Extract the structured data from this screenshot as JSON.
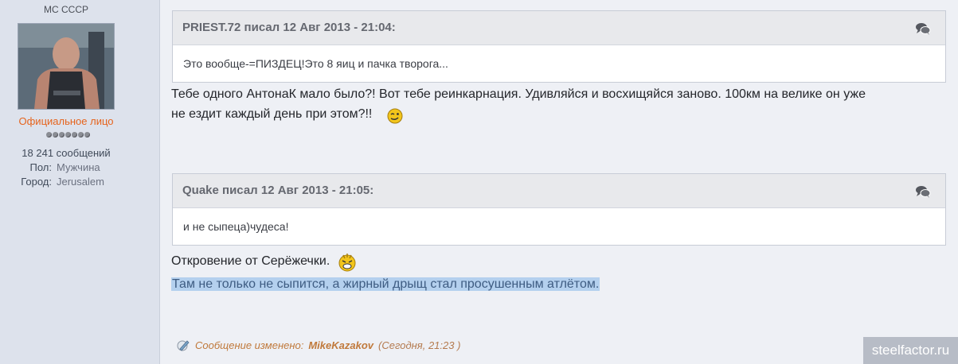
{
  "author": {
    "rank": "МС СССР",
    "role": "Официальное лицо",
    "posts": "18 241 сообщений",
    "gender_label": "Пол:",
    "gender": "Мужчина",
    "city_label": "Город:",
    "city": "Jerusalem",
    "pips_count": 7
  },
  "quote1": {
    "header": "PRIEST.72 писал 12 Авг 2013 - 21:04:",
    "body": "Это вообще-=ПИЗДЕЦ!Это 8 яиц и пачка творога...",
    "icon": "speech-bubbles-icon"
  },
  "reply1": {
    "line1": "Тебе одного АнтонаК мало было?! Вот тебе реинкарнация. Удивляйся и восхищяйся заново. 100км на велике он уже",
    "line2": "не ездит каждый день при этом?!!"
  },
  "quote2": {
    "header": "Quake писал 12 Авг 2013 - 21:05:",
    "body": "и не сыпеца)чудеса!",
    "icon": "speech-bubbles-icon"
  },
  "reply2": {
    "line1": "Откровение от Серёжечки.",
    "line2": "Там не только не сыпится, а жирный дрыщ стал просушенным атлётом."
  },
  "edited": {
    "label": "Сообщение изменено:",
    "user": "MikeKazakov",
    "time": "(Сегодня, 21:23 )"
  },
  "watermark": "steelfactor.ru",
  "colors": {
    "sidebar_bg": "#dde2ec",
    "role_orange": "#e6641d",
    "selection": "#b4d0ee"
  }
}
